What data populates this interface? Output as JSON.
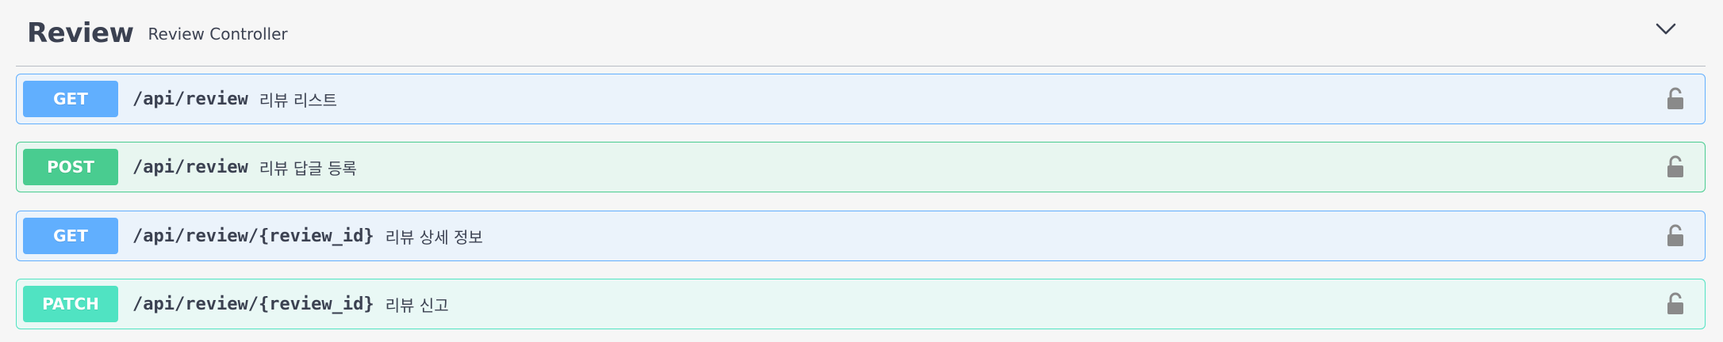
{
  "tag": {
    "name": "Review",
    "description": "Review Controller",
    "expand_icon": "chevron-down-icon"
  },
  "operations": [
    {
      "method": "GET",
      "path": "/api/review",
      "summary": "리뷰 리스트",
      "lock_icon": "unlocked-lock-icon"
    },
    {
      "method": "POST",
      "path": "/api/review",
      "summary": "리뷰 답글 등록",
      "lock_icon": "unlocked-lock-icon"
    },
    {
      "method": "GET",
      "path": "/api/review/{review_id}",
      "summary": "리뷰 상세 정보",
      "lock_icon": "unlocked-lock-icon"
    },
    {
      "method": "PATCH",
      "path": "/api/review/{review_id}",
      "summary": "리뷰 신고",
      "lock_icon": "unlocked-lock-icon"
    }
  ],
  "colors": {
    "get": "#61affe",
    "post": "#49cc90",
    "patch": "#50e3c2",
    "text": "#3b4151",
    "lock": "#8a8a8a"
  }
}
